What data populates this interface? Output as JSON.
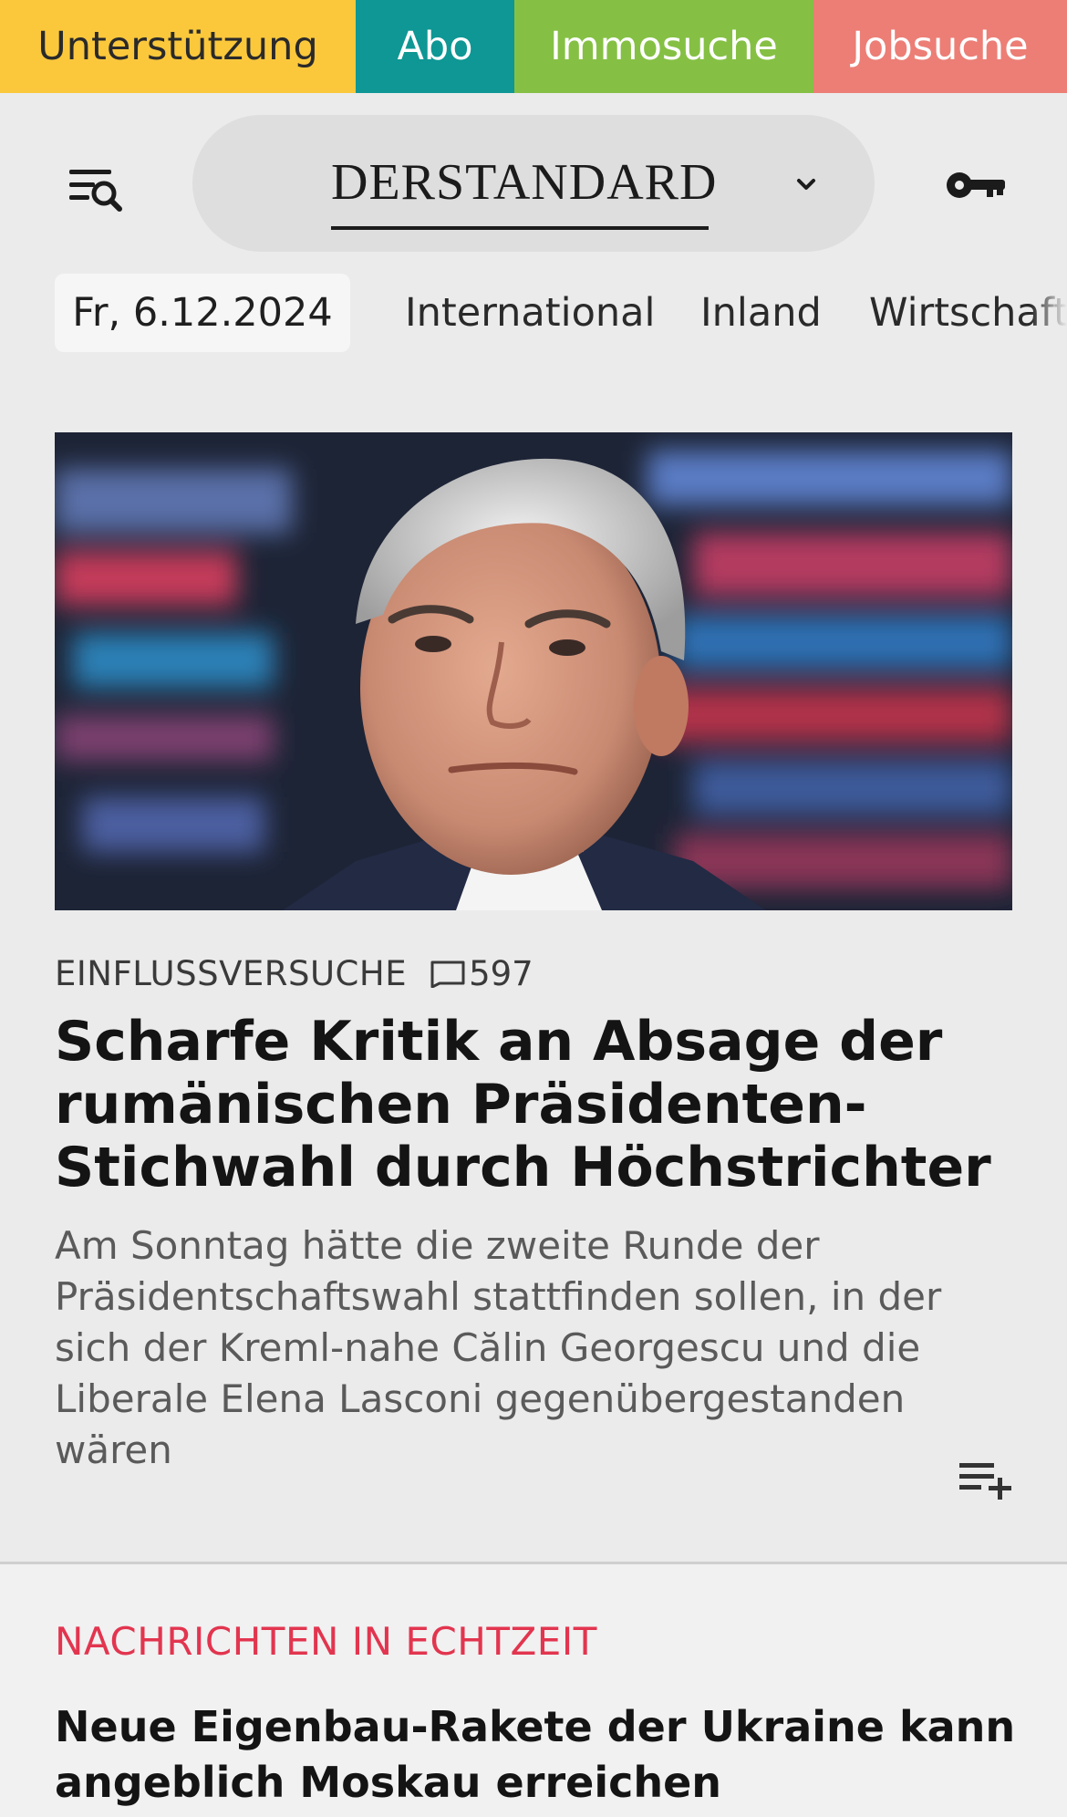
{
  "service_bar": {
    "support": "Unterstützung",
    "abo": "Abo",
    "immo": "Immosuche",
    "jobs": "Jobsuche",
    "colors": {
      "support": "#fbc83c",
      "abo": "#0e9794",
      "immo": "#85c044",
      "jobs": "#ec7e76"
    }
  },
  "header": {
    "menu_icon": "menu-search-icon",
    "logo": "DERSTANDARD",
    "logo_dropdown_icon": "chevron-down-icon",
    "login_icon": "key-icon"
  },
  "nav": {
    "date": "Fr, 6.12.2024",
    "items": [
      "International",
      "Inland",
      "Wirtschaft"
    ]
  },
  "hero": {
    "kicker": "EINFLUSSVERSUCHE",
    "comment_icon": "comment-icon",
    "comments": "597",
    "headline": "Scharfe Kritik an Absage der rumänischen Präsidenten-Stichwahl durch Höchstrichter",
    "teaser": "Am Sonntag hätte die zweite Runde der Präsident­schaftswahl stattfinden sollen, in der sich der Kreml-nahe Călin Georgescu und die Liberale Elena Lasconi gegenübergestanden wären",
    "playlist_icon": "playlist-add-icon"
  },
  "live": {
    "heading": "NACHRICHTEN IN ECHTZEIT",
    "heading_color": "#e2354f",
    "first_item": "Neue Eigenbau-Rakete der Ukraine kann angeb­lich Moskau erreichen"
  }
}
